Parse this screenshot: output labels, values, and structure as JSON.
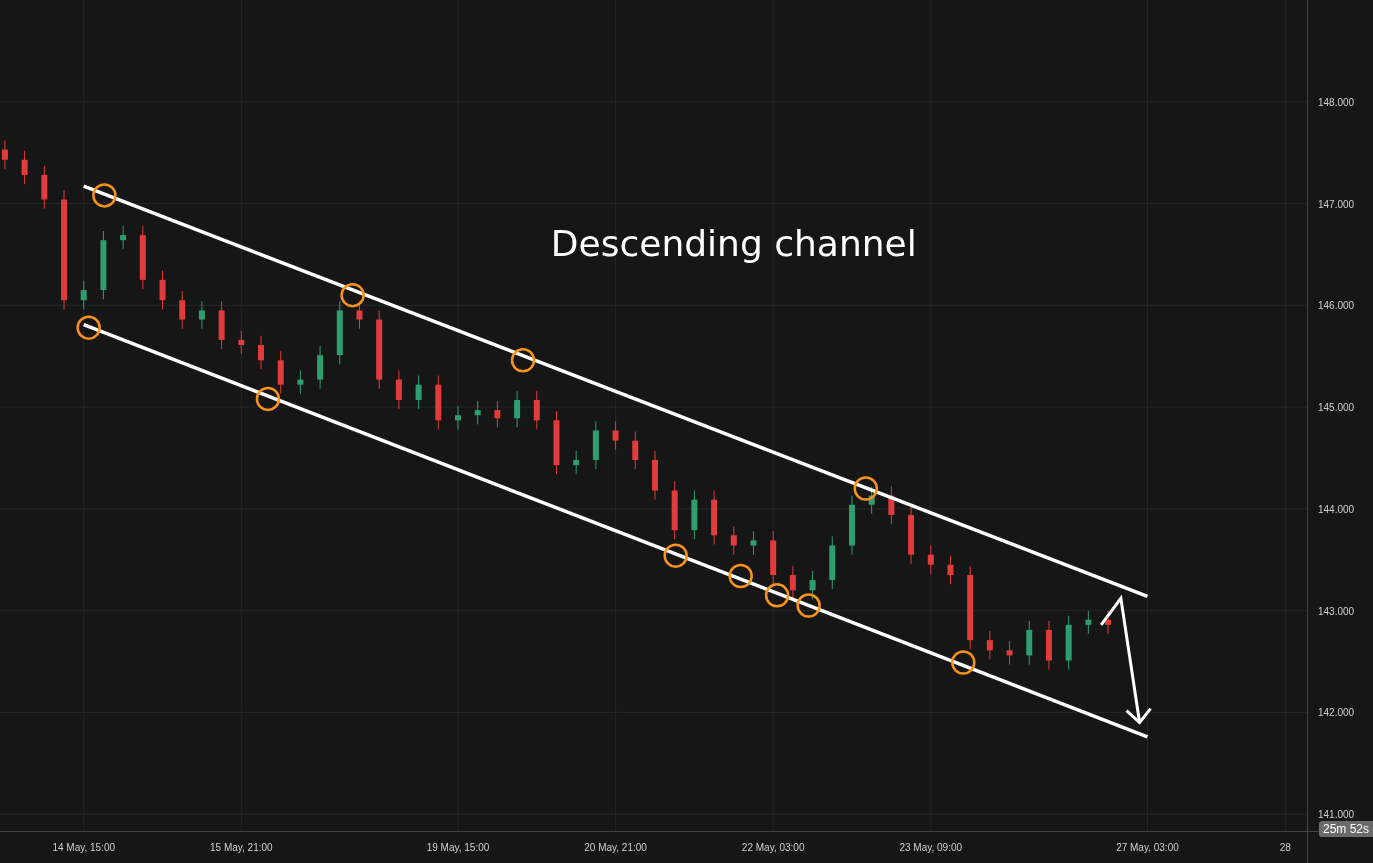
{
  "chart": {
    "chart_data": {
      "type": "candlestick",
      "grid": true,
      "ylim": [
        140.52,
        149.0
      ],
      "categories": [
        null,
        null,
        null,
        null,
        "14 May, 15:00",
        null,
        null,
        null,
        null,
        null,
        null,
        null,
        "15 May, 21:00",
        null,
        null,
        null,
        null,
        null,
        null,
        null,
        null,
        null,
        null,
        "19 May, 15:00",
        null,
        null,
        null,
        null,
        null,
        null,
        null,
        "20 May, 21:00",
        null,
        null,
        null,
        null,
        null,
        null,
        null,
        "22 May, 03:00",
        null,
        null,
        null,
        null,
        null,
        null,
        null,
        "23 May, 09:00",
        null,
        null,
        null,
        null,
        null,
        null,
        null,
        null,
        null,
        null,
        "27 May, 03:00",
        null,
        null,
        null,
        null,
        null,
        null,
        "28"
      ],
      "yticks": [
        {
          "value": 148,
          "label": "148.000"
        },
        {
          "value": 147,
          "label": "147.000"
        },
        {
          "value": 146,
          "label": "146.000"
        },
        {
          "value": 145,
          "label": "145.000"
        },
        {
          "value": 144,
          "label": "144.000"
        },
        {
          "value": 143,
          "label": "143.000"
        },
        {
          "value": 142,
          "label": "142.000"
        },
        {
          "value": 141,
          "label": "141.000"
        }
      ],
      "ohlc": [
        [
          147.53,
          147.62,
          147.34,
          147.43
        ],
        [
          147.43,
          147.52,
          147.19,
          147.28
        ],
        [
          147.28,
          147.37,
          146.95,
          147.04
        ],
        [
          147.04,
          147.13,
          145.96,
          146.05
        ],
        [
          146.05,
          146.24,
          145.96,
          146.15
        ],
        [
          146.15,
          146.73,
          146.06,
          146.64
        ],
        [
          146.64,
          146.78,
          146.55,
          146.69
        ],
        [
          146.69,
          146.78,
          146.16,
          146.25
        ],
        [
          146.25,
          146.34,
          145.96,
          146.05
        ],
        [
          146.05,
          146.14,
          145.77,
          145.86
        ],
        [
          145.86,
          146.04,
          145.77,
          145.95
        ],
        [
          145.95,
          146.04,
          145.57,
          145.66
        ],
        [
          145.66,
          145.75,
          145.52,
          145.61
        ],
        [
          145.61,
          145.7,
          145.37,
          145.46
        ],
        [
          145.46,
          145.55,
          145.13,
          145.22
        ],
        [
          145.22,
          145.36,
          145.13,
          145.27
        ],
        [
          145.27,
          145.6,
          145.18,
          145.51
        ],
        [
          145.51,
          146.04,
          145.42,
          145.95
        ],
        [
          145.95,
          146.04,
          145.77,
          145.86
        ],
        [
          145.86,
          145.95,
          145.18,
          145.27
        ],
        [
          145.27,
          145.36,
          144.98,
          145.07
        ],
        [
          145.07,
          145.31,
          144.98,
          145.22
        ],
        [
          145.22,
          145.31,
          144.78,
          144.87
        ],
        [
          144.87,
          145.01,
          144.78,
          144.92
        ],
        [
          144.92,
          145.06,
          144.83,
          144.97
        ],
        [
          144.97,
          145.06,
          144.8,
          144.89
        ],
        [
          144.89,
          145.16,
          144.8,
          145.07
        ],
        [
          145.07,
          145.16,
          144.78,
          144.87
        ],
        [
          144.87,
          144.96,
          144.34,
          144.43
        ],
        [
          144.43,
          144.57,
          144.34,
          144.48
        ],
        [
          144.48,
          144.86,
          144.39,
          144.77
        ],
        [
          144.77,
          144.86,
          144.58,
          144.67
        ],
        [
          144.67,
          144.76,
          144.39,
          144.48
        ],
        [
          144.48,
          144.57,
          144.09,
          144.18
        ],
        [
          144.18,
          144.27,
          143.7,
          143.79
        ],
        [
          143.79,
          144.18,
          143.7,
          144.09
        ],
        [
          144.09,
          144.18,
          143.65,
          143.74
        ],
        [
          143.74,
          143.83,
          143.55,
          143.64
        ],
        [
          143.64,
          143.78,
          143.55,
          143.69
        ],
        [
          143.69,
          143.78,
          143.26,
          143.35
        ],
        [
          143.35,
          143.44,
          143.11,
          143.2
        ],
        [
          143.2,
          143.39,
          143.11,
          143.3
        ],
        [
          143.3,
          143.73,
          143.21,
          143.64
        ],
        [
          143.64,
          144.13,
          143.55,
          144.04
        ],
        [
          144.04,
          144.22,
          143.95,
          144.13
        ],
        [
          144.13,
          144.22,
          143.85,
          143.94
        ],
        [
          143.94,
          144.03,
          143.46,
          143.55
        ],
        [
          143.55,
          143.64,
          143.36,
          143.45
        ],
        [
          143.45,
          143.54,
          143.26,
          143.35
        ],
        [
          143.35,
          143.44,
          142.62,
          142.71
        ],
        [
          142.71,
          142.8,
          142.52,
          142.61
        ],
        [
          142.61,
          142.7,
          142.47,
          142.56
        ],
        [
          142.56,
          142.9,
          142.47,
          142.81
        ],
        [
          142.81,
          142.9,
          142.42,
          142.51
        ],
        [
          142.51,
          142.95,
          142.42,
          142.86
        ],
        [
          142.86,
          143.0,
          142.77,
          142.91
        ],
        [
          142.91,
          143.0,
          142.77,
          142.86
        ],
        null,
        null,
        null,
        null,
        null,
        null,
        null,
        null,
        null
      ],
      "annotations": [
        "Descending channel"
      ]
    }
  },
  "countdown": "25m 52s"
}
